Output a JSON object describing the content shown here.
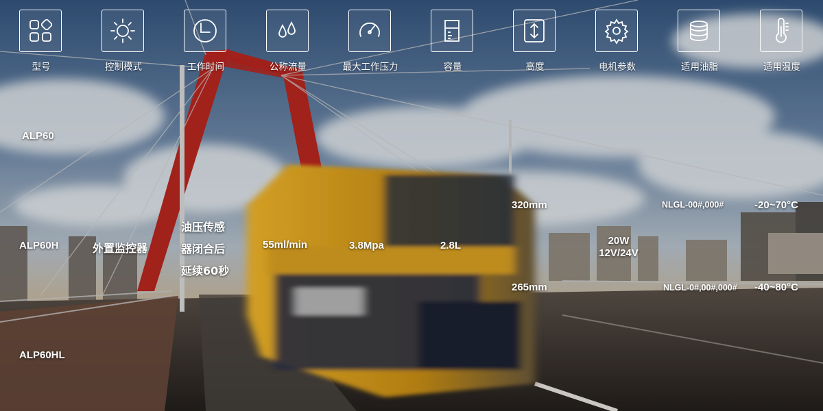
{
  "header": {
    "columns": [
      {
        "label": "型号",
        "icon": "model-grid-icon"
      },
      {
        "label": "控制模式",
        "icon": "sun-icon"
      },
      {
        "label": "工作时间",
        "icon": "clock-icon"
      },
      {
        "label": "公称流量",
        "icon": "droplets-icon"
      },
      {
        "label": "最大工作压力",
        "icon": "gauge-icon"
      },
      {
        "label": "容量",
        "icon": "beaker-icon"
      },
      {
        "label": "高度",
        "icon": "height-arrows-icon"
      },
      {
        "label": "电机参数",
        "icon": "gear-icon"
      },
      {
        "label": "适用油脂",
        "icon": "grease-tub-icon"
      },
      {
        "label": "适用温度",
        "icon": "thermometer-icon"
      }
    ]
  },
  "models": {
    "alp60": "ALP60",
    "alp60h": "ALP60H",
    "alp60hl": "ALP60HL"
  },
  "specs": {
    "control_mode": "外置监控器",
    "work_time": [
      "油压传感",
      "器闭合后",
      "延续60秒"
    ],
    "flow": "55ml/min",
    "pressure": "3.8Mpa",
    "capacity": "2.8L",
    "height_1": "320mm",
    "height_2": "265mm",
    "motor": [
      "20W",
      "12V/24V"
    ],
    "grease_1": "NLGL-00#,000#",
    "grease_2": "NLGL-0#,00#,000#",
    "temp_1": "-20~70°C",
    "temp_2": "-40~80°C"
  },
  "colors": {
    "sky_top": "#3c5e86",
    "sky_mid": "#8fa6bf",
    "tower_red": "#b8261f",
    "truck_yellow": "#e0a81a",
    "road": "#2e2a28"
  }
}
